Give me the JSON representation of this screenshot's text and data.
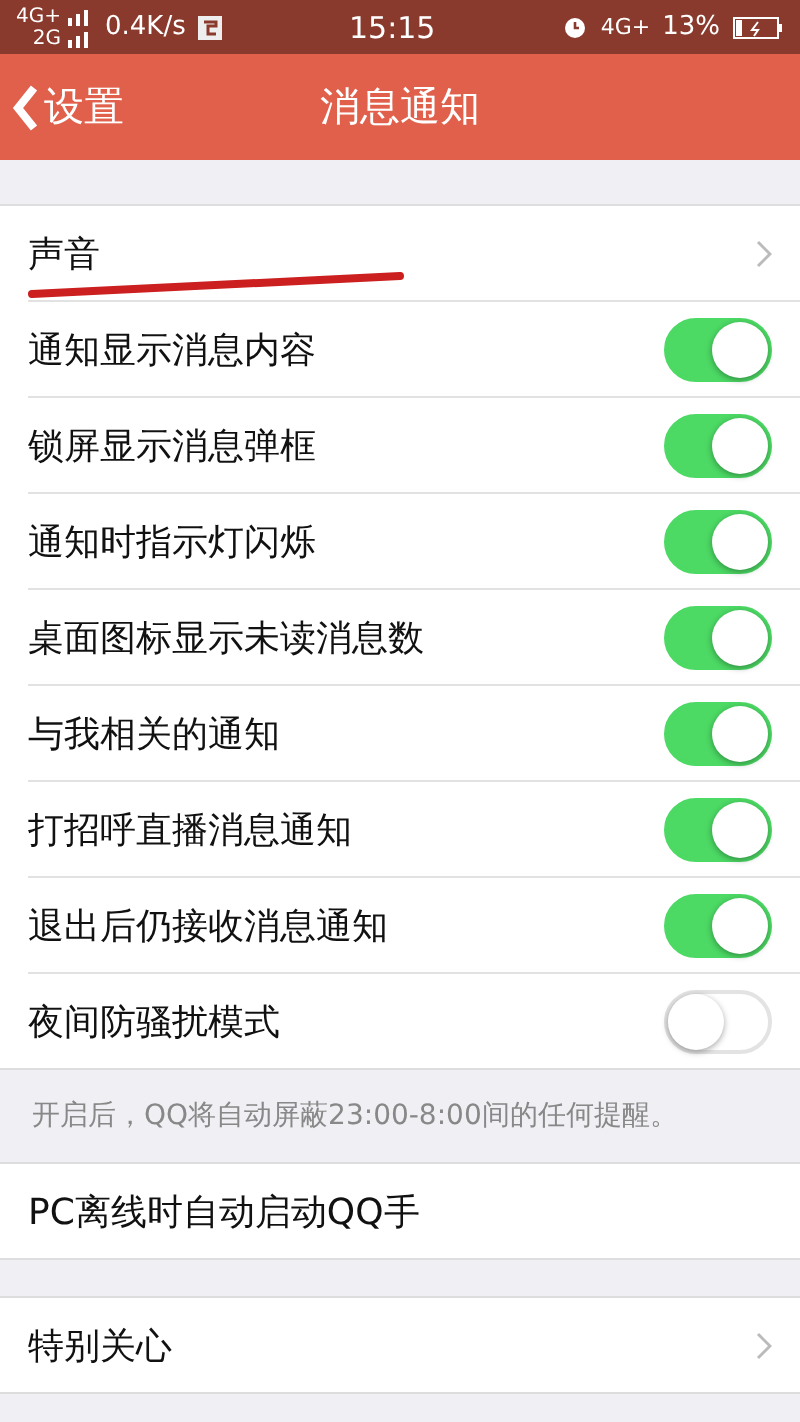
{
  "status_bar": {
    "network_top": "4G+",
    "network_bottom": "2G",
    "speed": "0.4K/s",
    "time": "15:15",
    "network_right": "4G+",
    "battery": "13%"
  },
  "nav": {
    "back": "设置",
    "title": "消息通知"
  },
  "rows": [
    {
      "kind": "link",
      "label": "声音",
      "underlined": true
    },
    {
      "kind": "toggle",
      "label": "通知显示消息内容",
      "on": true
    },
    {
      "kind": "toggle",
      "label": "锁屏显示消息弹框",
      "on": true
    },
    {
      "kind": "toggle",
      "label": "通知时指示灯闪烁",
      "on": true
    },
    {
      "kind": "toggle",
      "label": "桌面图标显示未读消息数",
      "on": true
    },
    {
      "kind": "toggle",
      "label": "与我相关的通知",
      "on": true
    },
    {
      "kind": "toggle",
      "label": "打招呼直播消息通知",
      "on": true
    },
    {
      "kind": "toggle",
      "label": "退出后仍接收消息通知",
      "on": true
    },
    {
      "kind": "toggle",
      "label": "夜间防骚扰模式",
      "on": false
    }
  ],
  "note": "开启后，QQ将自动屏蔽23:00-8:00间的任何提醒。",
  "rows_2": [
    {
      "kind": "plain",
      "label": "PC离线时自动启动QQ手"
    }
  ],
  "rows_3": [
    {
      "kind": "link",
      "label": "特别关心"
    }
  ]
}
